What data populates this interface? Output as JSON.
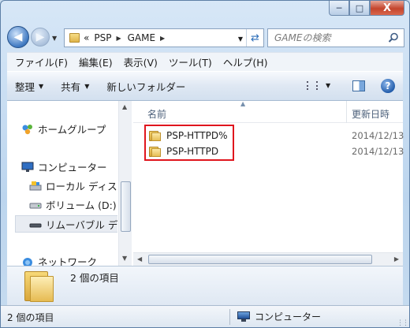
{
  "window": {
    "caption_buttons": {
      "minimize_glyph": "─",
      "maximize_glyph": "□",
      "close_glyph": "X"
    }
  },
  "address_bar": {
    "overflow_glyph": "«",
    "segments": [
      "PSP",
      "GAME"
    ],
    "separator_glyph": "▶"
  },
  "search": {
    "placeholder": "GAMEの検索"
  },
  "menu": {
    "items": [
      "ファイル(F)",
      "編集(E)",
      "表示(V)",
      "ツール(T)",
      "ヘルプ(H)"
    ]
  },
  "toolbar": {
    "organize_label": "整理",
    "share_label": "共有",
    "new_folder_label": "新しいフォルダー",
    "help_glyph": "?"
  },
  "nav_pane": {
    "items": [
      {
        "label": "ホームグループ",
        "icon": "homegroup-icon"
      },
      {
        "label": "コンピューター",
        "icon": "computer-icon"
      },
      {
        "label": "ローカル ディスク",
        "icon": "local-disk-icon"
      },
      {
        "label": "ボリューム (D:)",
        "icon": "drive-icon"
      },
      {
        "label": "リムーバブル デ",
        "icon": "removable-drive-icon"
      },
      {
        "label": "ネットワーク",
        "icon": "network-icon"
      }
    ]
  },
  "file_list": {
    "columns": {
      "name": "名前",
      "date": "更新日時"
    },
    "rows": [
      {
        "name": "PSP-HTTPD%",
        "date": "2014/12/13"
      },
      {
        "name": "PSP-HTTPD",
        "date": "2014/12/13"
      }
    ],
    "highlight_color": "#e0161e"
  },
  "details": {
    "item_count": "2 個の項目"
  },
  "status_bar": {
    "left": "2 個の項目",
    "right": "コンピューター"
  }
}
